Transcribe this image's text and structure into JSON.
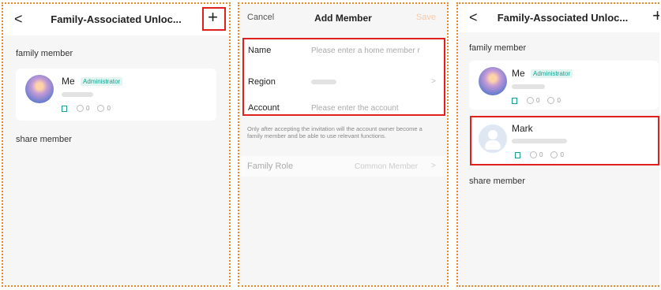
{
  "panel1": {
    "title": "Family-Associated Unloc...",
    "back_glyph": "<",
    "add_glyph": "+",
    "family_section": "family member",
    "member": {
      "name": "Me",
      "badge": "Administrator",
      "count_a": "0",
      "count_b": "0"
    },
    "share_section": "share member"
  },
  "panel2": {
    "cancel": "Cancel",
    "title": "Add Member",
    "save": "Save",
    "name_label": "Name",
    "name_placeholder": "Please enter a home member r",
    "region_label": "Region",
    "region_chevron": ">",
    "account_label": "Account",
    "account_placeholder": "Please enter the account",
    "note": "Only after accepting the invitation will the account owner become a family member and be able to use relevant functions.",
    "role_label": "Family Role",
    "role_value": "Common Member",
    "role_chevron": ">"
  },
  "panel3": {
    "title": "Family-Associated Unloc...",
    "back_glyph": "<",
    "add_glyph": "+",
    "family_section": "family member",
    "member1": {
      "name": "Me",
      "badge": "Administrator",
      "count_a": "0",
      "count_b": "0"
    },
    "member2": {
      "name": "Mark",
      "count_a": "0",
      "count_b": "0"
    },
    "share_section": "share member"
  }
}
